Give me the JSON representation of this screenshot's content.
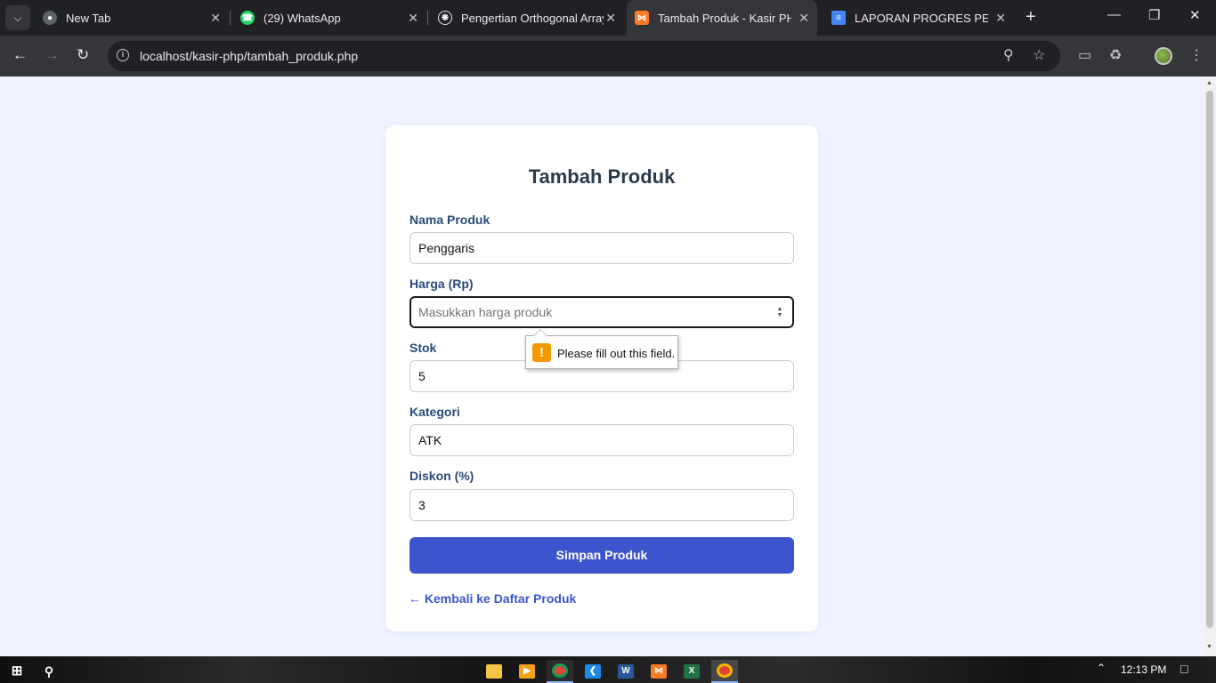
{
  "browser": {
    "tabs": [
      {
        "title": "New Tab",
        "icon": "chrome-icon"
      },
      {
        "title": "(29) WhatsApp",
        "icon": "whatsapp-icon"
      },
      {
        "title": "Pengertian Orthogonal Array",
        "icon": "openai-icon"
      },
      {
        "title": "Tambah Produk - Kasir PHP",
        "icon": "xampp-icon",
        "active": true
      },
      {
        "title": "LAPORAN PROGRES PENGUJIAN",
        "icon": "google-docs-icon"
      }
    ],
    "url": "localhost/kasir-php/tambah_produk.php"
  },
  "form": {
    "title": "Tambah Produk",
    "fields": {
      "nama": {
        "label": "Nama Produk",
        "value": "Penggaris"
      },
      "harga": {
        "label": "Harga (Rp)",
        "placeholder": "Masukkan harga produk",
        "value": ""
      },
      "stok": {
        "label": "Stok",
        "value": "5"
      },
      "kategori": {
        "label": "Kategori",
        "value": "ATK"
      },
      "diskon": {
        "label": "Diskon (%)",
        "value": "3"
      }
    },
    "submit_label": "Simpan Produk",
    "back_link": "← Kembali ke Daftar Produk",
    "validation_message": "Please fill out this field."
  },
  "taskbar": {
    "apps": [
      "file-explorer-icon",
      "media-player-icon",
      "chrome-icon",
      "vscode-icon",
      "word-icon",
      "xampp-icon",
      "excel-icon",
      "chrome-icon"
    ],
    "time": "12:13 PM"
  },
  "colors": {
    "page_bg": "#eef3ff",
    "accent": "#3c55cf",
    "label": "#2b4a7a",
    "warning": "#f29900"
  }
}
